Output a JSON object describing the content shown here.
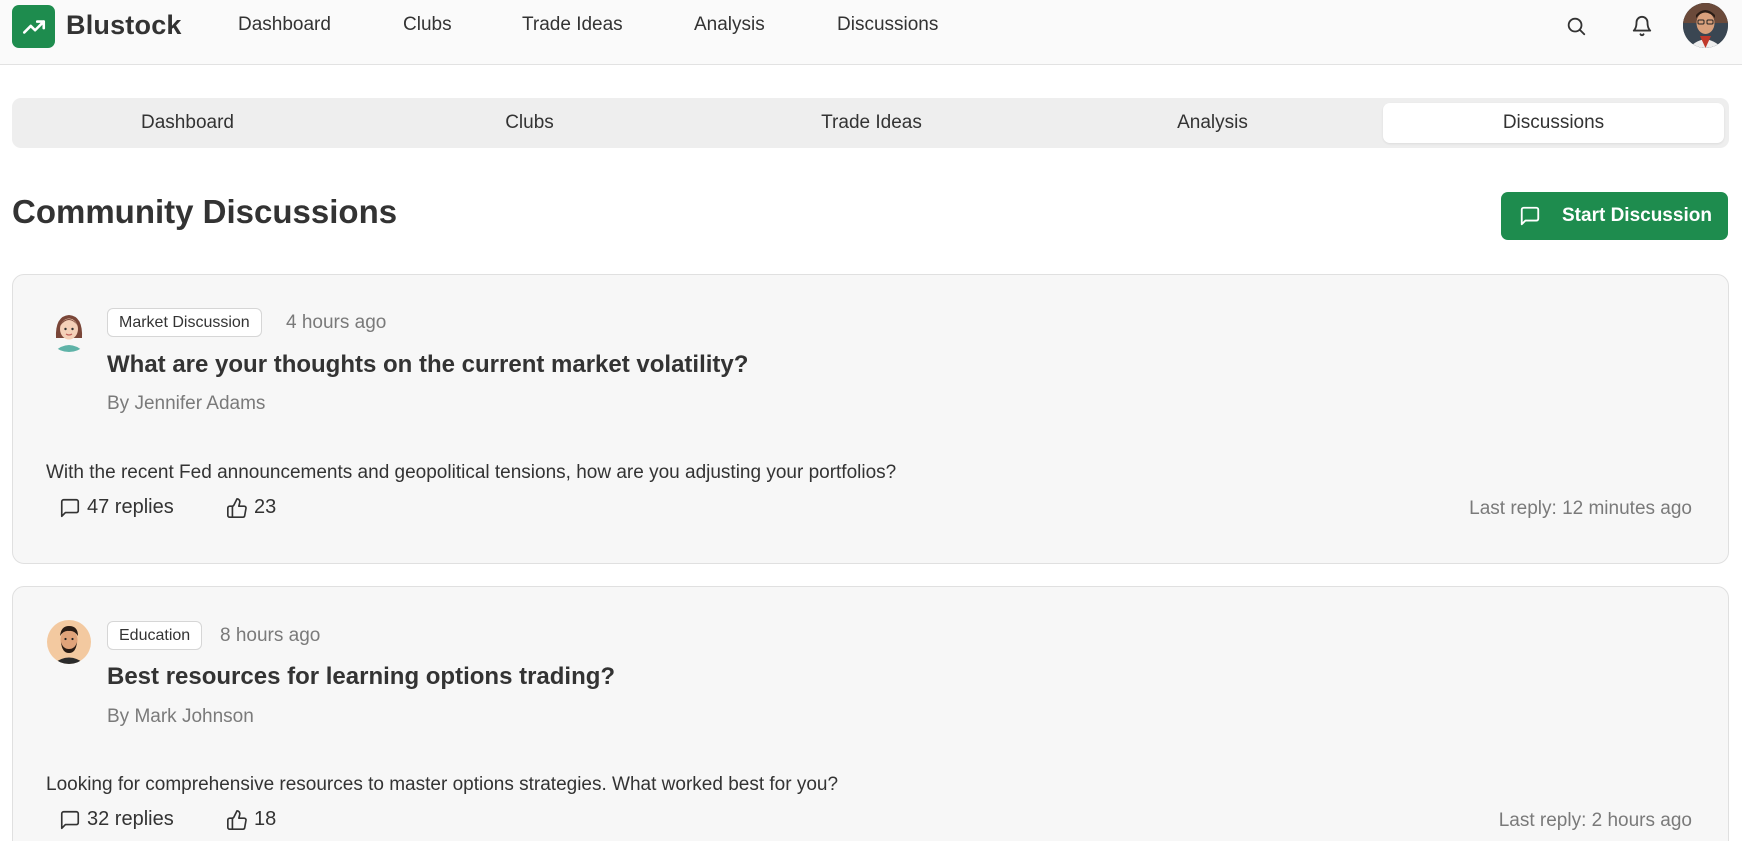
{
  "brand": {
    "name": "Blustock",
    "logo_icon": "trending-up-icon",
    "accent": "#1e8c4e"
  },
  "nav": {
    "links": [
      "Dashboard",
      "Clubs",
      "Trade Ideas",
      "Analysis",
      "Discussions"
    ],
    "icons": [
      "search-icon",
      "bell-icon"
    ]
  },
  "tabs": {
    "items": [
      "Dashboard",
      "Clubs",
      "Trade Ideas",
      "Analysis",
      "Discussions"
    ],
    "active": "Discussions"
  },
  "page": {
    "title": "Community Discussions",
    "start_button": {
      "label": "Start Discussion",
      "icon": "message-square-icon"
    }
  },
  "discussions": [
    {
      "tag": "Market Discussion",
      "time": "4 hours ago",
      "title": "What are your thoughts on the current market volatility?",
      "author": "By Jennifer Adams",
      "excerpt": "With the recent Fed announcements and geopolitical tensions, how are you adjusting your portfolios?",
      "replies": "47 replies",
      "likes": "23",
      "last_reply": "Last reply: 12 minutes ago"
    },
    {
      "tag": "Education",
      "time": "8 hours ago",
      "title": "Best resources for learning options trading?",
      "author": "By Mark Johnson",
      "excerpt": "Looking for comprehensive resources to master options strategies. What worked best for you?",
      "replies": "32 replies",
      "likes": "18",
      "last_reply": "Last reply: 2 hours ago"
    }
  ]
}
